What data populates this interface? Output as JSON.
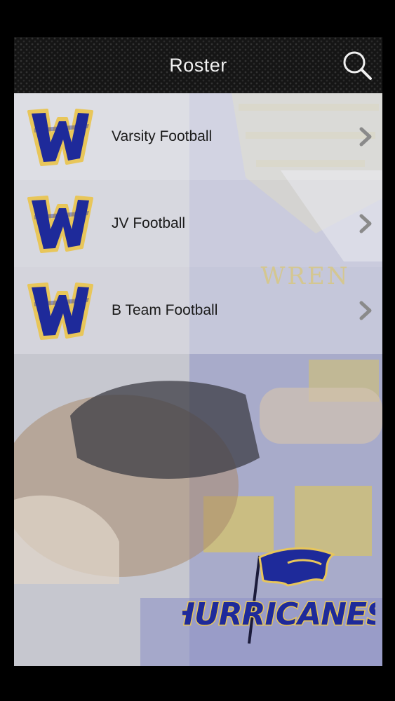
{
  "header": {
    "title": "Roster",
    "search_icon": "search-icon"
  },
  "roster": {
    "items": [
      {
        "label": "Varsity Football",
        "logo": "w-logo-icon",
        "chevron": "chevron-right-icon"
      },
      {
        "label": "JV Football",
        "logo": "w-logo-icon",
        "chevron": "chevron-right-icon"
      },
      {
        "label": "B Team Football",
        "logo": "w-logo-icon",
        "chevron": "chevron-right-icon"
      }
    ]
  },
  "background": {
    "jersey_text": "WREN",
    "team_logo_text": "HURRICANES"
  },
  "colors": {
    "header_bg": "#151515",
    "logo_blue": "#1e2a9a",
    "logo_gold": "#e8c65a",
    "text": "#1b1b1b"
  }
}
